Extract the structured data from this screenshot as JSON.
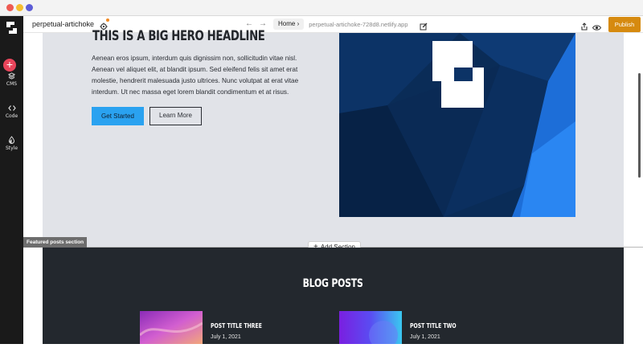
{
  "app": {
    "site_name": "perpetual-artichoke",
    "home_label": "Home",
    "url": "perpetual-artichoke-728d8.netlify.app",
    "publish_label": "Publish"
  },
  "sidebar": {
    "items": [
      {
        "label": "CMS",
        "icon": "layers-icon"
      },
      {
        "label": "Code",
        "icon": "code-icon"
      },
      {
        "label": "Style",
        "icon": "droplet-icon"
      }
    ]
  },
  "hero": {
    "headline": "THIS IS A BIG HERO HEADLINE",
    "body": "Aenean eros ipsum, interdum quis dignissim non, sollicitudin vitae nisl. Aenean vel aliquet elit, at blandit ipsum. Sed eleifend felis sit amet erat molestie, hendrerit malesuada justo ultrices. Nunc volutpat at erat vitae interdum. Ut nec massa eget lorem blandit condimentum et at risus.",
    "primary_button": "Get Started",
    "secondary_button": "Learn More"
  },
  "editor": {
    "section_label": "Featured posts section",
    "add_section_label": "Add Section"
  },
  "blog": {
    "title": "BLOG POSTS",
    "posts": [
      {
        "title": "POST TITLE THREE",
        "date": "July 1, 2021"
      },
      {
        "title": "POST TITLE TWO",
        "date": "July 1, 2021"
      }
    ]
  },
  "colors": {
    "accent": "#2aa2f0",
    "publish": "#d68a0f",
    "add_button": "#e8455b",
    "dark_section": "#23282e",
    "hero_bg": "#e1e3e8"
  }
}
